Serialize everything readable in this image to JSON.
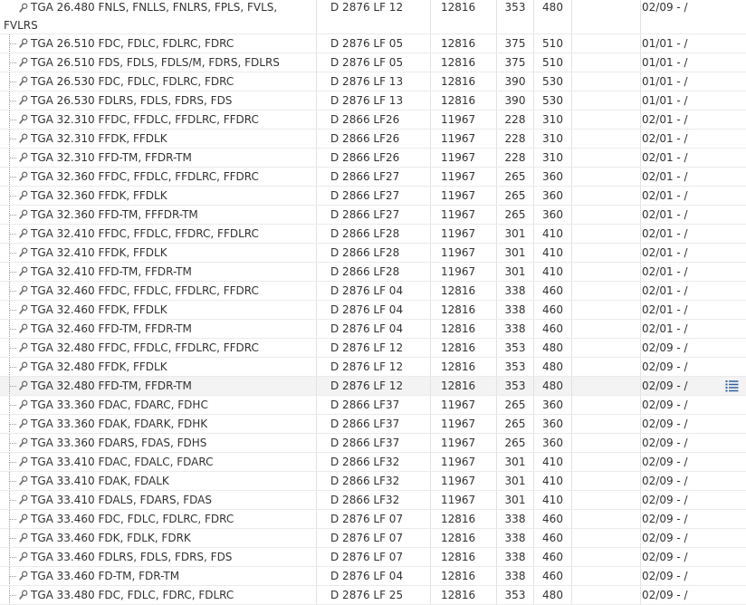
{
  "table": {
    "rows": [
      {
        "model": "TGA 26.480 FNLS, FNLLS, FNLRS, FPLS, FVLS, FVLRS",
        "engine": "D 2876 LF 12",
        "displacement": "12816",
        "kw": "353",
        "hp": "480",
        "production": "02/09 - /"
      },
      {
        "model": "TGA 26.510 FDC, FDLC, FDLRC, FDRC",
        "engine": "D 2876 LF 05",
        "displacement": "12816",
        "kw": "375",
        "hp": "510",
        "production": "01/01 - /"
      },
      {
        "model": "TGA 26.510 FDS, FDLS, FDLS/M, FDRS, FDLRS",
        "engine": "D 2876 LF 05",
        "displacement": "12816",
        "kw": "375",
        "hp": "510",
        "production": "01/01 - /"
      },
      {
        "model": "TGA 26.530 FDC, FDLC, FDLRC, FDRC",
        "engine": "D 2876 LF 13",
        "displacement": "12816",
        "kw": "390",
        "hp": "530",
        "production": "01/01 - /"
      },
      {
        "model": "TGA 26.530 FDLRS, FDLS, FDRS, FDS",
        "engine": "D 2876 LF 13",
        "displacement": "12816",
        "kw": "390",
        "hp": "530",
        "production": "01/01 - /"
      },
      {
        "model": "TGA 32.310 FFDC, FFDLC, FFDLRC, FFDRC",
        "engine": "D 2866 LF26",
        "displacement": "11967",
        "kw": "228",
        "hp": "310",
        "production": "02/01 - /"
      },
      {
        "model": "TGA 32.310 FFDK, FFDLK",
        "engine": "D 2866 LF26",
        "displacement": "11967",
        "kw": "228",
        "hp": "310",
        "production": "02/01 - /"
      },
      {
        "model": "TGA 32.310 FFD-TM, FFDR-TM",
        "engine": "D 2866 LF26",
        "displacement": "11967",
        "kw": "228",
        "hp": "310",
        "production": "02/01 - /"
      },
      {
        "model": "TGA 32.360 FFDC, FFDLC, FFDLRC, FFDRC",
        "engine": "D 2866 LF27",
        "displacement": "11967",
        "kw": "265",
        "hp": "360",
        "production": "02/01 - /"
      },
      {
        "model": "TGA 32.360 FFDK, FFDLK",
        "engine": "D 2866 LF27",
        "displacement": "11967",
        "kw": "265",
        "hp": "360",
        "production": "02/01 - /"
      },
      {
        "model": "TGA 32.360 FFD-TM, FFFDR-TM",
        "engine": "D 2866 LF27",
        "displacement": "11967",
        "kw": "265",
        "hp": "360",
        "production": "02/01 - /"
      },
      {
        "model": "TGA 32.410 FFDC, FFDLC, FFDRC, FFDLRC",
        "engine": "D 2866 LF28",
        "displacement": "11967",
        "kw": "301",
        "hp": "410",
        "production": "02/01 - /"
      },
      {
        "model": "TGA 32.410 FFDK, FFDLK",
        "engine": "D 2866 LF28",
        "displacement": "11967",
        "kw": "301",
        "hp": "410",
        "production": "02/01 - /"
      },
      {
        "model": "TGA 32.410 FFD-TM, FFDR-TM",
        "engine": "D 2866 LF28",
        "displacement": "11967",
        "kw": "301",
        "hp": "410",
        "production": "02/01 - /"
      },
      {
        "model": "TGA 32.460 FFDC, FFDLC, FFDLRC, FFDRC",
        "engine": "D 2876 LF 04",
        "displacement": "12816",
        "kw": "338",
        "hp": "460",
        "production": "02/01 - /"
      },
      {
        "model": "TGA 32.460 FFDK, FFDLK",
        "engine": "D 2876 LF 04",
        "displacement": "12816",
        "kw": "338",
        "hp": "460",
        "production": "02/01 - /"
      },
      {
        "model": "TGA 32.460 FFD-TM, FFDR-TM",
        "engine": "D 2876 LF 04",
        "displacement": "12816",
        "kw": "338",
        "hp": "460",
        "production": "02/01 - /"
      },
      {
        "model": "TGA 32.480 FFDC, FFDLC, FFDLRC, FFDRC",
        "engine": "D 2876 LF 12",
        "displacement": "12816",
        "kw": "353",
        "hp": "480",
        "production": "02/09 - /"
      },
      {
        "model": "TGA 32.480 FFDK, FFDLK",
        "engine": "D 2876 LF 12",
        "displacement": "12816",
        "kw": "353",
        "hp": "480",
        "production": "02/09 - /"
      },
      {
        "model": "TGA 32.480 FFD-TM, FFDR-TM",
        "engine": "D 2876 LF 12",
        "displacement": "12816",
        "kw": "353",
        "hp": "480",
        "production": "02/09 - /",
        "highlight": true
      },
      {
        "model": "TGA 33.360 FDAC, FDARC, FDHC",
        "engine": "D 2866 LF37",
        "displacement": "11967",
        "kw": "265",
        "hp": "360",
        "production": "02/09 - /"
      },
      {
        "model": "TGA 33.360 FDAK, FDARK, FDHK",
        "engine": "D 2866 LF37",
        "displacement": "11967",
        "kw": "265",
        "hp": "360",
        "production": "02/09 - /"
      },
      {
        "model": "TGA 33.360 FDARS, FDAS, FDHS",
        "engine": "D 2866 LF37",
        "displacement": "11967",
        "kw": "265",
        "hp": "360",
        "production": "02/09 - /"
      },
      {
        "model": "TGA 33.410 FDAC, FDALC, FDARC",
        "engine": "D 2866 LF32",
        "displacement": "11967",
        "kw": "301",
        "hp": "410",
        "production": "02/09 - /"
      },
      {
        "model": "TGA 33.410 FDAK, FDALK",
        "engine": "D 2866 LF32",
        "displacement": "11967",
        "kw": "301",
        "hp": "410",
        "production": "02/09 - /"
      },
      {
        "model": "TGA 33.410 FDALS, FDARS, FDAS",
        "engine": "D 2866 LF32",
        "displacement": "11967",
        "kw": "301",
        "hp": "410",
        "production": "02/09 - /"
      },
      {
        "model": "TGA 33.460 FDC, FDLC, FDLRC, FDRC",
        "engine": "D 2876 LF 07",
        "displacement": "12816",
        "kw": "338",
        "hp": "460",
        "production": "02/09 - /"
      },
      {
        "model": "TGA 33.460 FDK, FDLK, FDRK",
        "engine": "D 2876 LF 07",
        "displacement": "12816",
        "kw": "338",
        "hp": "460",
        "production": "02/09 - /"
      },
      {
        "model": "TGA 33.460 FDLRS, FDLS, FDRS, FDS",
        "engine": "D 2876 LF 07",
        "displacement": "12816",
        "kw": "338",
        "hp": "460",
        "production": "02/09 - /"
      },
      {
        "model": "TGA 33.460 FD-TM, FDR-TM",
        "engine": "D 2876 LF 04",
        "displacement": "12816",
        "kw": "338",
        "hp": "460",
        "production": "02/09 - /"
      },
      {
        "model": "TGA 33.480 FDC, FDLC, FDRC, FDLRC",
        "engine": "D 2876 LF 25",
        "displacement": "12816",
        "kw": "353",
        "hp": "480",
        "production": "02/09 - /"
      }
    ]
  },
  "icons": {
    "row_icon": "magnifier-icon",
    "row_menu": "list-menu-icon"
  },
  "colors": {
    "text": "#333333",
    "grid_line": "#e2e2e2",
    "hover_row": "#f3f3f3",
    "menu_icon": "#2f5f9e"
  }
}
